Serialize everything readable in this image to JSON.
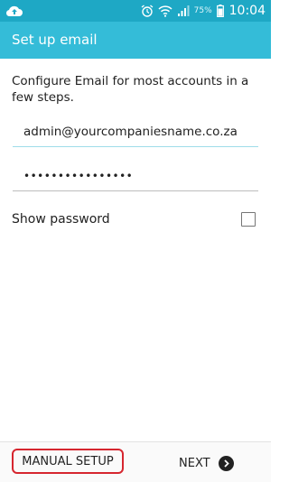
{
  "status_bar": {
    "left_icon": "cloud-upload-icon",
    "icons": [
      "alarm-icon",
      "wifi-icon",
      "signal-icon",
      "battery-icon"
    ],
    "battery_text": "75%",
    "time": "10:04",
    "color": "#1ea8c5"
  },
  "app_bar": {
    "title": "Set up email",
    "color": "#34bcd8"
  },
  "form": {
    "intro": "Configure Email for most accounts in a few steps.",
    "email_value": "admin@yourcompaniesname.co.za",
    "password_value": "••••••••••••••••",
    "show_password_label": "Show password",
    "show_password_checked": false
  },
  "actions": {
    "manual_setup_label": "MANUAL SETUP",
    "next_label": "NEXT",
    "highlight_color": "#d6262f"
  }
}
